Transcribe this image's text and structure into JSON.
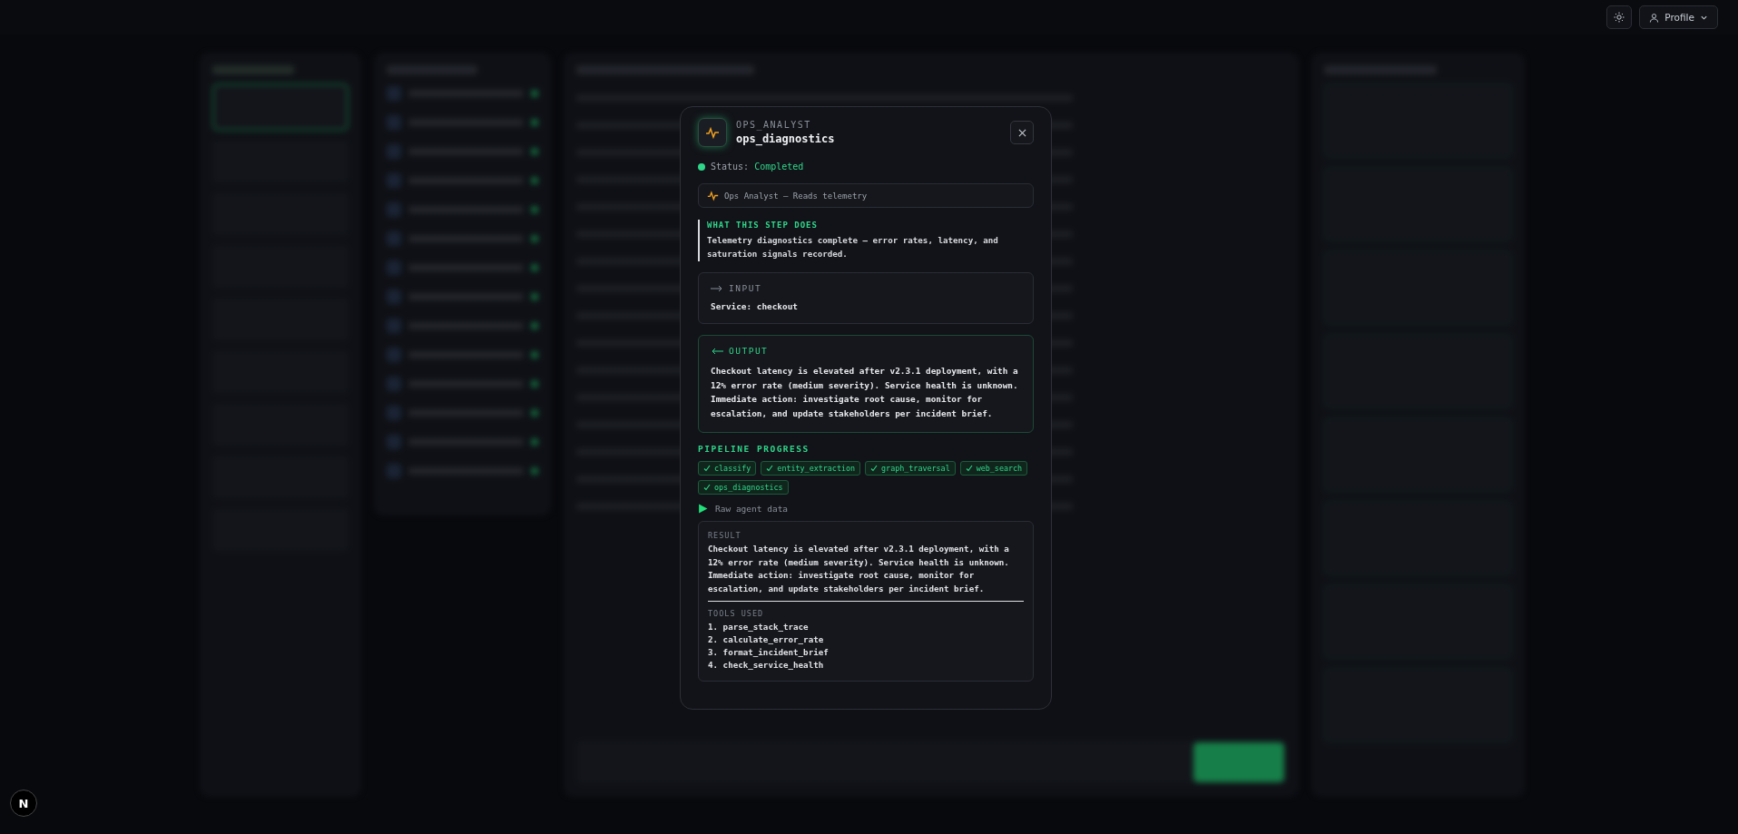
{
  "topbar": {
    "profile_button": "Profile"
  },
  "dev_badge": "N",
  "modal": {
    "agent": "OPS_ANALYST",
    "step": "ops_diagnostics",
    "status_label": "Status:",
    "status": "Completed",
    "agent_line": "Ops Analyst — Reads telemetry",
    "description": {
      "heading": "WHAT THIS STEP DOES",
      "text": "Telemetry diagnostics complete — error rates, latency, and saturation signals recorded."
    },
    "input": {
      "label": "INPUT",
      "text": "Service: checkout"
    },
    "output": {
      "label": "OUTPUT",
      "text": "Checkout latency is elevated after v2.3.1 deployment, with a 12% error rate (medium severity). Service health is unknown. Immediate action: investigate root cause, monitor for escalation, and update stakeholders per incident brief."
    },
    "pipeline": {
      "heading": "PIPELINE PROGRESS",
      "steps": [
        {
          "label": "classify",
          "done": true
        },
        {
          "label": "entity_extraction",
          "done": true
        },
        {
          "label": "graph_traversal",
          "done": true
        },
        {
          "label": "web_search",
          "done": true
        },
        {
          "label": "ops_diagnostics",
          "done": true
        }
      ]
    },
    "raw_toggle": "Raw agent data",
    "raw": {
      "result_label": "RESULT",
      "result": "Checkout latency is elevated after v2.3.1 deployment, with a 12% error rate (medium severity). Service health is unknown. Immediate action: investigate root cause, monitor for escalation, and update stakeholders per incident brief.",
      "tools_label": "TOOLS USED",
      "tools": [
        "1. parse_stack_trace",
        "2. calculate_error_rate",
        "3. format_incident_brief",
        "4. check_service_health"
      ]
    }
  }
}
